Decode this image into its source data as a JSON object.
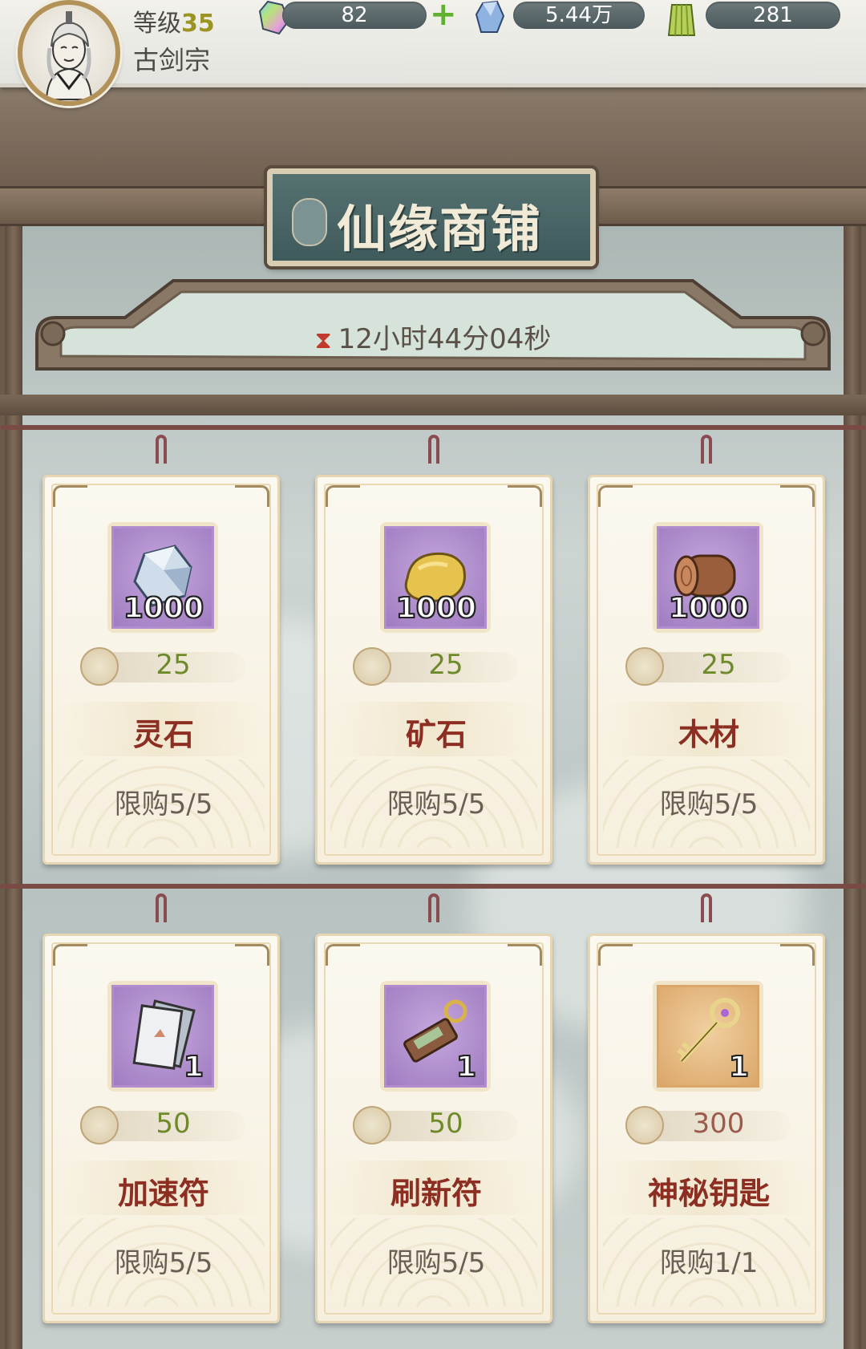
{
  "player": {
    "level_label": "等级",
    "level": "35",
    "sect": "古剑宗"
  },
  "resources": {
    "crystal": "82",
    "spirit_stone": "5.44万",
    "jade_coin": "281"
  },
  "shop": {
    "title": "仙缘商铺",
    "timer": "12小时44分04秒"
  },
  "items": [
    {
      "name": "灵石",
      "qty": "1000",
      "price": "25",
      "limit": "限购5/5",
      "icon": "spirit-stone-icon"
    },
    {
      "name": "矿石",
      "qty": "1000",
      "price": "25",
      "limit": "限购5/5",
      "icon": "ore-icon"
    },
    {
      "name": "木材",
      "qty": "1000",
      "price": "25",
      "limit": "限购5/5",
      "icon": "wood-icon"
    },
    {
      "name": "加速符",
      "qty": "1",
      "price": "50",
      "limit": "限购5/5",
      "icon": "speed-talisman-icon"
    },
    {
      "name": "刷新符",
      "qty": "1",
      "price": "50",
      "limit": "限购5/5",
      "icon": "refresh-talisman-icon"
    },
    {
      "name": "神秘钥匙",
      "qty": "1",
      "price": "300",
      "limit": "限购1/1",
      "icon": "mystery-key-icon"
    }
  ],
  "colors": {
    "price_green": "#6e8a2a",
    "price_red": "#9b5a4c",
    "name_red": "#8c2e22",
    "rare_purple": "#a884c8",
    "epic_orange": "#dba769"
  }
}
